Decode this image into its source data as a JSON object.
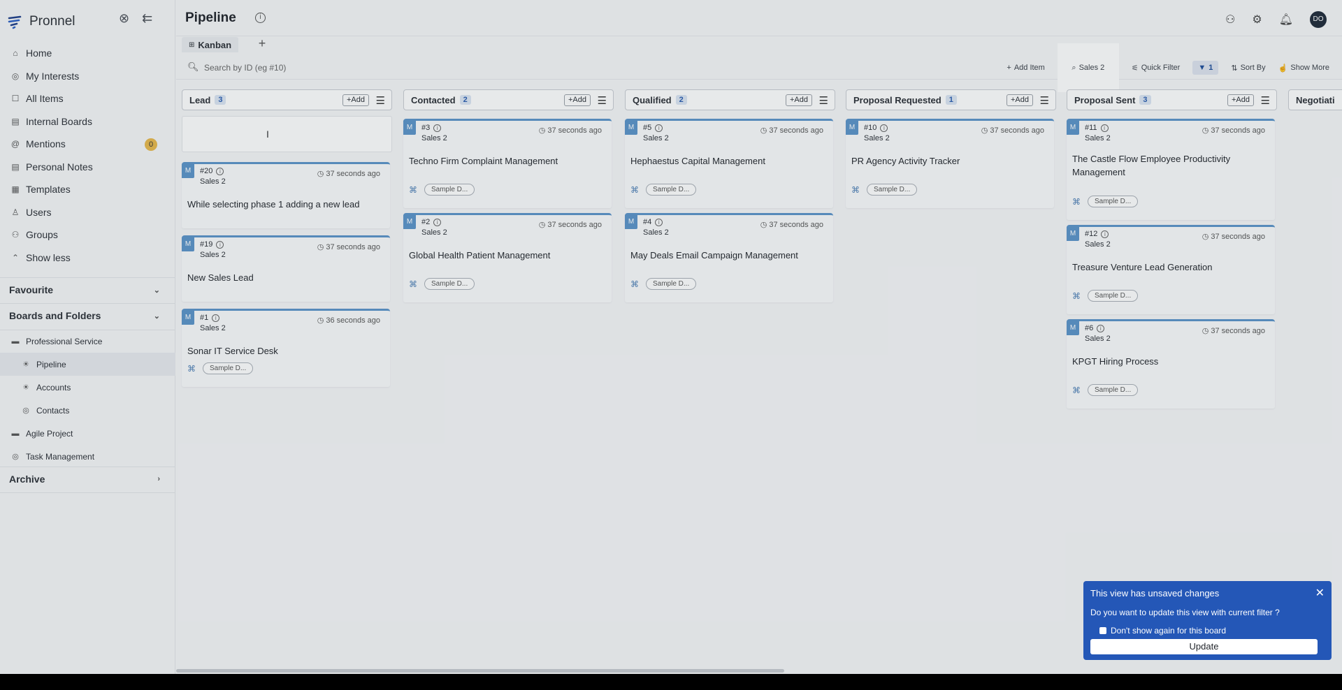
{
  "app": {
    "name": "Pronnel"
  },
  "sidebar": {
    "nav": [
      {
        "label": "Home",
        "icon": "home-icon"
      },
      {
        "label": "My Interests",
        "icon": "interests-icon"
      },
      {
        "label": "All Items",
        "icon": "all-items-icon"
      },
      {
        "label": "Internal Boards",
        "icon": "boards-icon"
      },
      {
        "label": "Mentions",
        "icon": "mention-icon",
        "badge": "0"
      },
      {
        "label": "Personal Notes",
        "icon": "notes-icon"
      },
      {
        "label": "Templates",
        "icon": "templates-icon"
      },
      {
        "label": "Users",
        "icon": "user-icon"
      },
      {
        "label": "Groups",
        "icon": "groups-icon"
      },
      {
        "label": "Show less",
        "icon": "chevron-up-icon"
      }
    ],
    "favourite_label": "Favourite",
    "boards_label": "Boards and Folders",
    "tree": [
      {
        "label": "Professional Service",
        "level": 1,
        "icon": "folder-icon"
      },
      {
        "label": "Pipeline",
        "level": 2,
        "icon": "bulb-icon",
        "active": true
      },
      {
        "label": "Accounts",
        "level": 2,
        "icon": "bulb-icon"
      },
      {
        "label": "Contacts",
        "level": 2,
        "icon": "target-icon"
      },
      {
        "label": "Agile Project",
        "level": 1,
        "icon": "folder-icon"
      },
      {
        "label": "Task Management",
        "level": 1,
        "icon": "target-icon"
      }
    ],
    "archive_label": "Archive"
  },
  "header": {
    "title": "Pipeline",
    "avatar_initials": "DO"
  },
  "tabs": [
    {
      "label": "Kanban"
    }
  ],
  "toolbar": {
    "search_placeholder": "Search by ID (eg #10)",
    "add_item": "Add Item",
    "sales_filter": "Sales 2",
    "quick_filter": "Quick Filter",
    "filter_count": "1",
    "sort_by": "Sort By",
    "show_more": "Show More"
  },
  "columns": [
    {
      "name": "Lead",
      "count": "3",
      "add": "+Add",
      "cards": [
        {
          "id": "#20",
          "board": "Sales 2",
          "time": "37 seconds ago",
          "title": "While selecting phase 1 adding a new lead",
          "tag": ""
        },
        {
          "id": "#19",
          "board": "Sales 2",
          "time": "37 seconds ago",
          "title": "New Sales Lead",
          "tag": ""
        },
        {
          "id": "#1",
          "board": "Sales 2",
          "time": "36 seconds ago",
          "title": "Sonar IT Service Desk",
          "tag": "Sample D..."
        }
      ]
    },
    {
      "name": "Contacted",
      "count": "2",
      "add": "+Add",
      "cards": [
        {
          "id": "#3",
          "board": "Sales 2",
          "time": "37 seconds ago",
          "title": "Techno Firm Complaint Management",
          "tag": "Sample D..."
        },
        {
          "id": "#2",
          "board": "Sales 2",
          "time": "37 seconds ago",
          "title": "Global Health Patient Management",
          "tag": "Sample D..."
        }
      ]
    },
    {
      "name": "Qualified",
      "count": "2",
      "add": "+Add",
      "cards": [
        {
          "id": "#5",
          "board": "Sales 2",
          "time": "37 seconds ago",
          "title": "Hephaestus Capital Management",
          "tag": "Sample D..."
        },
        {
          "id": "#4",
          "board": "Sales 2",
          "time": "37 seconds ago",
          "title": "May Deals Email Campaign Management",
          "tag": "Sample D..."
        }
      ]
    },
    {
      "name": "Proposal Requested",
      "count": "1",
      "add": "+Add",
      "cards": [
        {
          "id": "#10",
          "board": "Sales 2",
          "time": "37 seconds ago",
          "title": "PR Agency Activity Tracker",
          "tag": "Sample D..."
        }
      ]
    },
    {
      "name": "Proposal Sent",
      "count": "3",
      "add": "+Add",
      "cards": [
        {
          "id": "#11",
          "board": "Sales 2",
          "time": "37 seconds ago",
          "title": "The Castle Flow Employee Productivity Management",
          "tag": "Sample D..."
        },
        {
          "id": "#12",
          "board": "Sales 2",
          "time": "37 seconds ago",
          "title": "Treasure Venture Lead Generation",
          "tag": "Sample D..."
        },
        {
          "id": "#6",
          "board": "Sales 2",
          "time": "37 seconds ago",
          "title": "KPGT Hiring Process",
          "tag": "Sample D..."
        }
      ]
    },
    {
      "name": "Negotiati",
      "count": "",
      "add": "",
      "cards": []
    }
  ],
  "popup": {
    "title": "This view has unsaved changes",
    "message": "Do you want to update this view with current filter ?",
    "checkbox_label": "Don't show again for this board",
    "button": "Update"
  }
}
